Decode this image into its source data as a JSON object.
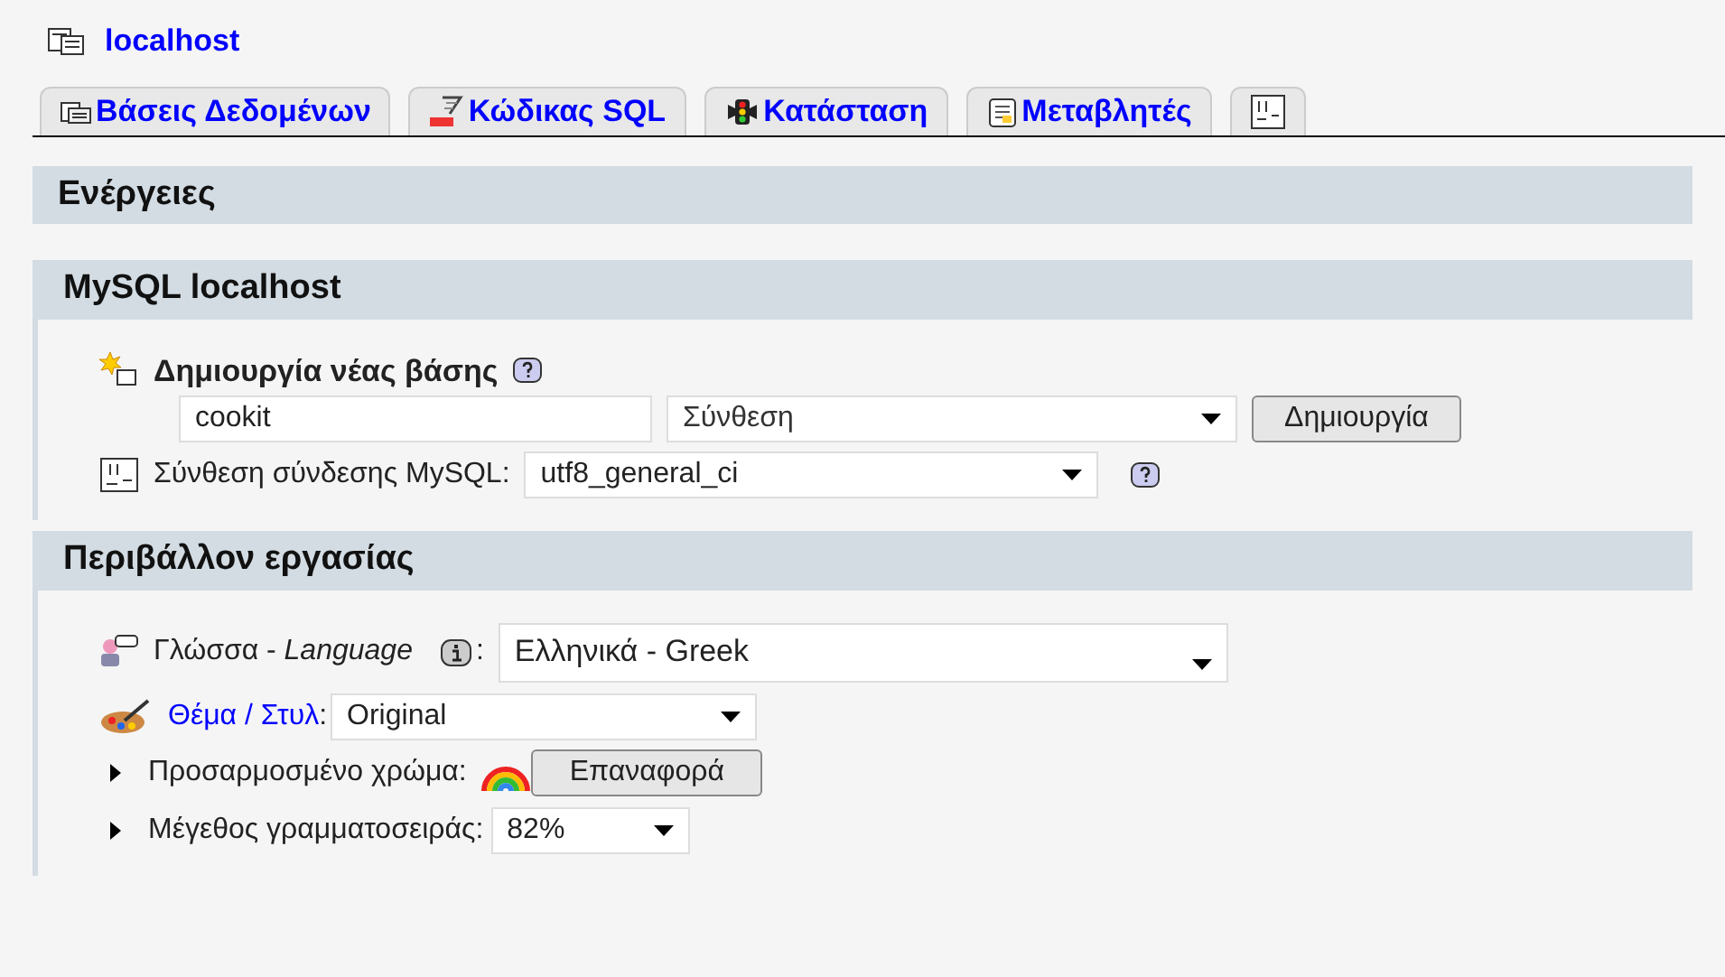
{
  "server": {
    "title": "localhost"
  },
  "tabs": [
    {
      "label": "Βάσεις Δεδομένων",
      "selected": false
    },
    {
      "label": "Κώδικας SQL",
      "selected": false
    },
    {
      "label": "Κατάσταση",
      "selected": false
    },
    {
      "label": "Μεταβλητές",
      "selected": false
    }
  ],
  "actions": {
    "title": "Ενέργειες"
  },
  "mysql": {
    "title": "MySQL localhost",
    "create_db": {
      "label": "Δημιουργία νέας βάσης",
      "name_value": "cookit",
      "collation_placeholder": "Σύνθεση",
      "button": "Δημιουργία"
    },
    "connection_collation": {
      "label": "Σύνθεση σύνδεσης MySQL:",
      "value": "utf8_general_ci"
    }
  },
  "environment": {
    "title": "Περιβάλλον εργασίας",
    "language": {
      "label": "Γλώσσα - ",
      "label_italic": "Language",
      "colon": ":",
      "value": "Ελληνικά - Greek"
    },
    "theme": {
      "label": "Θέμα / Στυλ",
      "colon": ":",
      "value": "Original"
    },
    "custom_color": {
      "label": "Προσαρμοσμένο χρώμα:",
      "expanded": false,
      "button": "Επαναφορά"
    },
    "font_size": {
      "label": "Μέγεθος γραμματοσειράς:",
      "expanded": false,
      "value": "82%"
    }
  }
}
